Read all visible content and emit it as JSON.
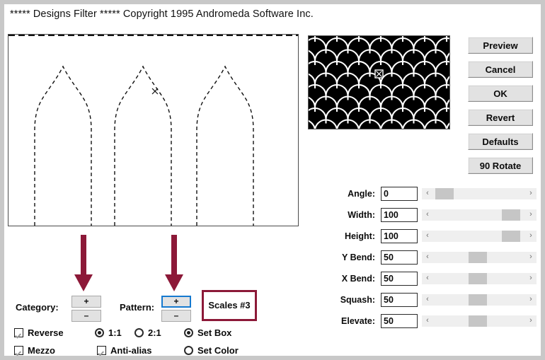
{
  "window": {
    "title": "***** Designs Filter *****  Copyright 1995 Andromeda Software Inc.",
    "frame_color": "#c8c8c8"
  },
  "colors": {
    "accent_maroon": "#8c1938",
    "focus_blue": "#1579cf",
    "button_face": "#e2e2e2",
    "slider_track": "#efefef",
    "slider_thumb": "#c6c6c6",
    "preview_bg": "#000000",
    "preview_stroke": "#ffffff"
  },
  "canvas": {
    "name": "design-preview-canvas",
    "description": "three dashed gothic ogee arch outlines",
    "marker": "x"
  },
  "pattern_preview": {
    "name": "pattern-thumbnail",
    "pattern": "scales",
    "background": "#000000",
    "stroke": "#ffffff",
    "cursor_marker": "x"
  },
  "buttons": [
    {
      "label": "Preview",
      "name": "preview-button"
    },
    {
      "label": "Cancel",
      "name": "cancel-button"
    },
    {
      "label": "OK",
      "name": "ok-button"
    },
    {
      "label": "Revert",
      "name": "revert-button"
    },
    {
      "label": "Defaults",
      "name": "defaults-button"
    },
    {
      "label": "90 Rotate",
      "name": "rotate-90-button"
    }
  ],
  "sliders": [
    {
      "label": "Angle:",
      "value": "0",
      "percent": 3,
      "name": "angle"
    },
    {
      "label": "Width:",
      "value": "100",
      "percent": 93,
      "name": "width"
    },
    {
      "label": "Height:",
      "value": "100",
      "percent": 93,
      "name": "height"
    },
    {
      "label": "Y Bend:",
      "value": "50",
      "percent": 48,
      "name": "y-bend"
    },
    {
      "label": "X Bend:",
      "value": "50",
      "percent": 48,
      "name": "x-bend"
    },
    {
      "label": "Squash:",
      "value": "50",
      "percent": 48,
      "name": "squash"
    },
    {
      "label": "Elevate:",
      "value": "50",
      "percent": 48,
      "name": "elevate"
    }
  ],
  "slider_arrows": {
    "left": "‹",
    "right": "›"
  },
  "bottom": {
    "category_label": "Category:",
    "pattern_label": "Pattern:",
    "plus": "+",
    "minus": "–",
    "pattern_name": "Scales #3"
  },
  "options": {
    "reverse": {
      "label": "Reverse",
      "checked": true
    },
    "mezzo": {
      "label": "Mezzo",
      "checked": true
    },
    "anti_alias": {
      "label": "Anti-alias",
      "checked": true
    },
    "ratio_1_1": {
      "label": "1:1",
      "selected": true
    },
    "ratio_2_1": {
      "label": "2:1",
      "selected": false
    },
    "set_box": {
      "label": "Set Box",
      "selected": true
    },
    "set_color": {
      "label": "Set Color",
      "selected": false
    }
  },
  "annotations": [
    {
      "name": "arrow-to-category-buttons",
      "color": "#8c1938"
    },
    {
      "name": "arrow-to-pattern-buttons",
      "color": "#8c1938"
    }
  ]
}
